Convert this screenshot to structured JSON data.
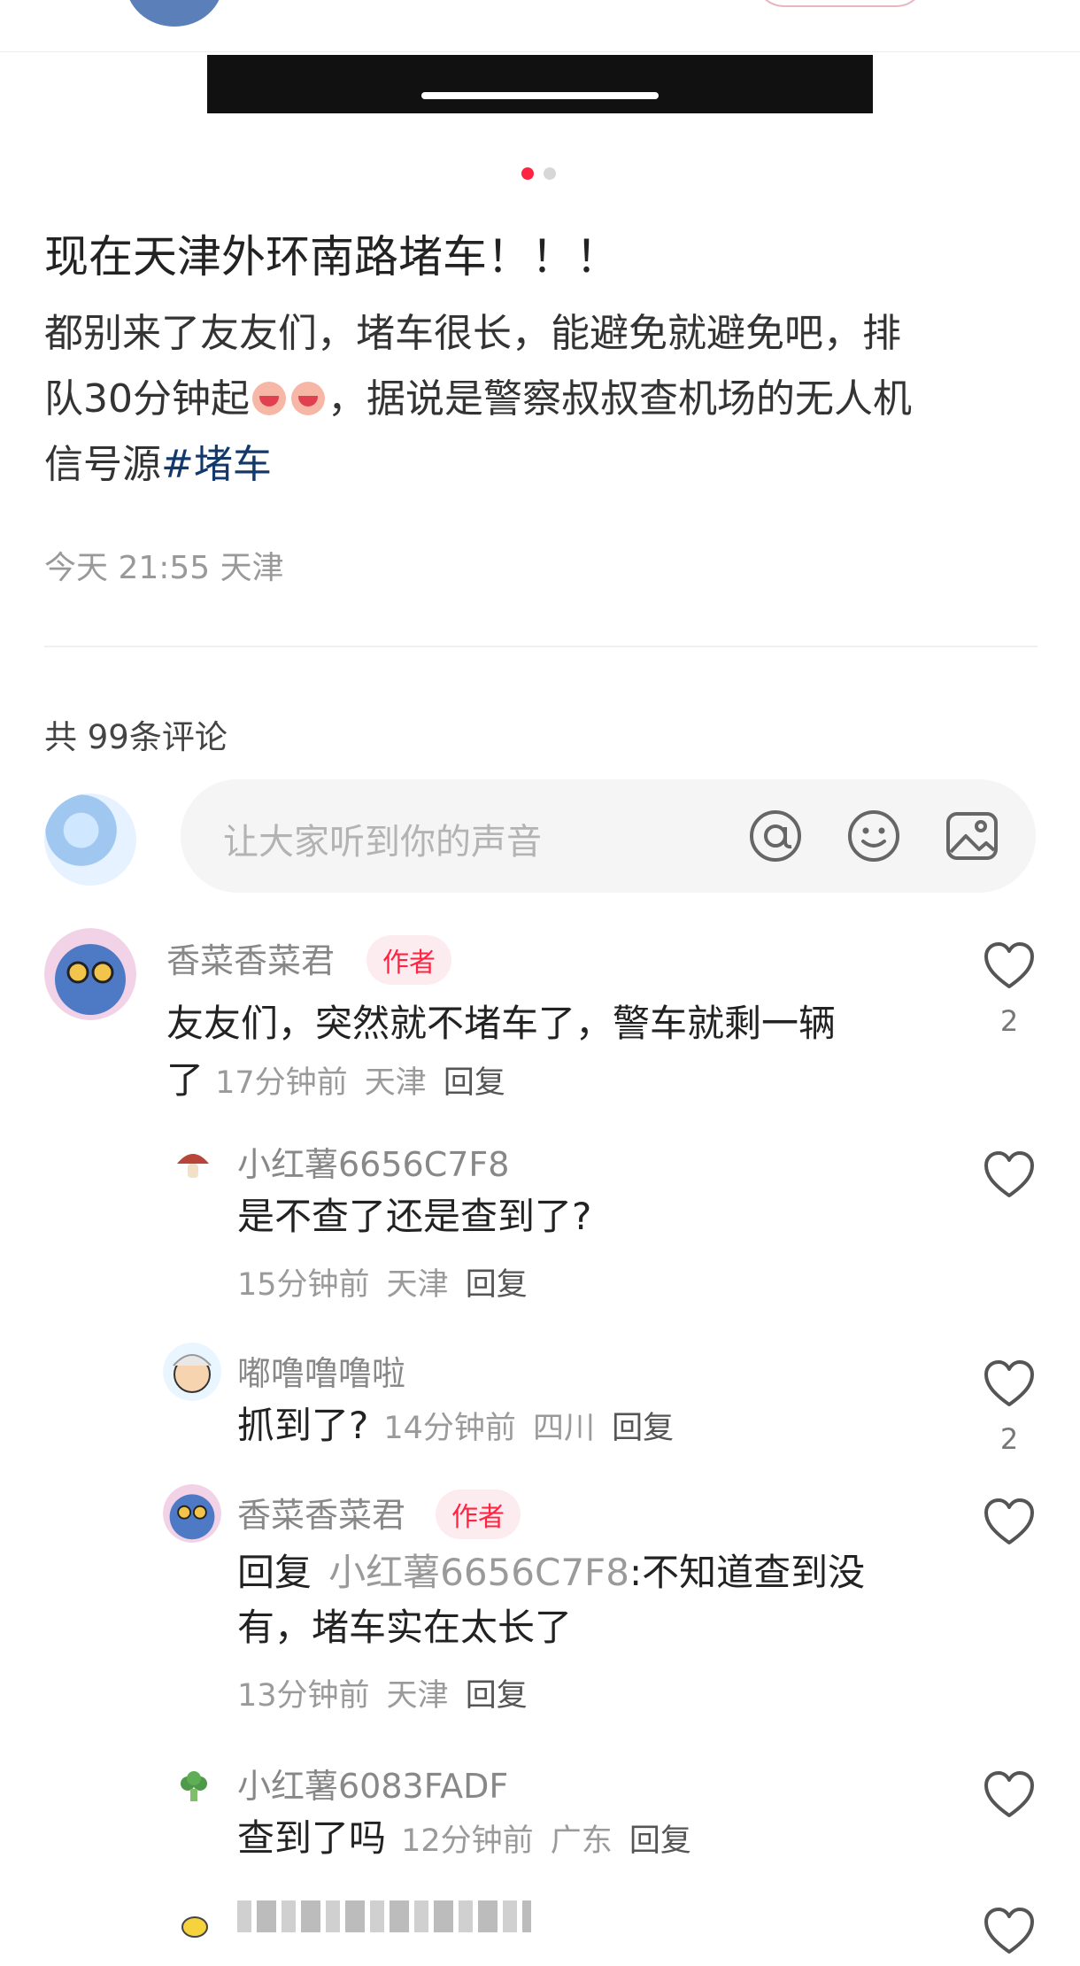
{
  "post": {
    "title": "现在天津外环南路堵车！！！",
    "body_line1": "都别来了友友们，堵车很长，能避免就避免吧，排",
    "body_line2_a": "队30分钟起",
    "body_line2_b": "，据说是警察叔叔查机场的无人机",
    "body_line3": "信号源",
    "hashtag": "#堵车",
    "meta": "今天 21:55 天津"
  },
  "comments_header": {
    "count_label": "共 99条评论"
  },
  "comment_input": {
    "placeholder": "让大家听到你的声音"
  },
  "comments": [
    {
      "name": "香菜香菜君",
      "tag": "作者",
      "text_l1": "友友们，突然就不堵车了，警车就剩一辆",
      "text_l2": "了",
      "time": "17分钟前",
      "loc": "天津",
      "reply": "回复",
      "likes": "2"
    },
    {
      "name": "小红薯6656C7F8",
      "text": "是不查了还是查到了?",
      "time": "15分钟前",
      "loc": "天津",
      "reply": "回复"
    },
    {
      "name": "嘟噜噜噜啦",
      "text": "抓到了?",
      "time": "14分钟前",
      "loc": "四川",
      "reply": "回复",
      "likes": "2"
    },
    {
      "name": "香菜香菜君",
      "tag": "作者",
      "reply_prefix": "回复",
      "reply_to": "小红薯6656C7F8",
      "text_l1": ":不知道查到没",
      "text_l2": "有，堵车实在太长了",
      "time": "13分钟前",
      "loc": "天津",
      "reply": "回复"
    },
    {
      "name": "小红薯6083FADF",
      "text": "查到了吗",
      "time": "12分钟前",
      "loc": "广东",
      "reply": "回复"
    }
  ]
}
